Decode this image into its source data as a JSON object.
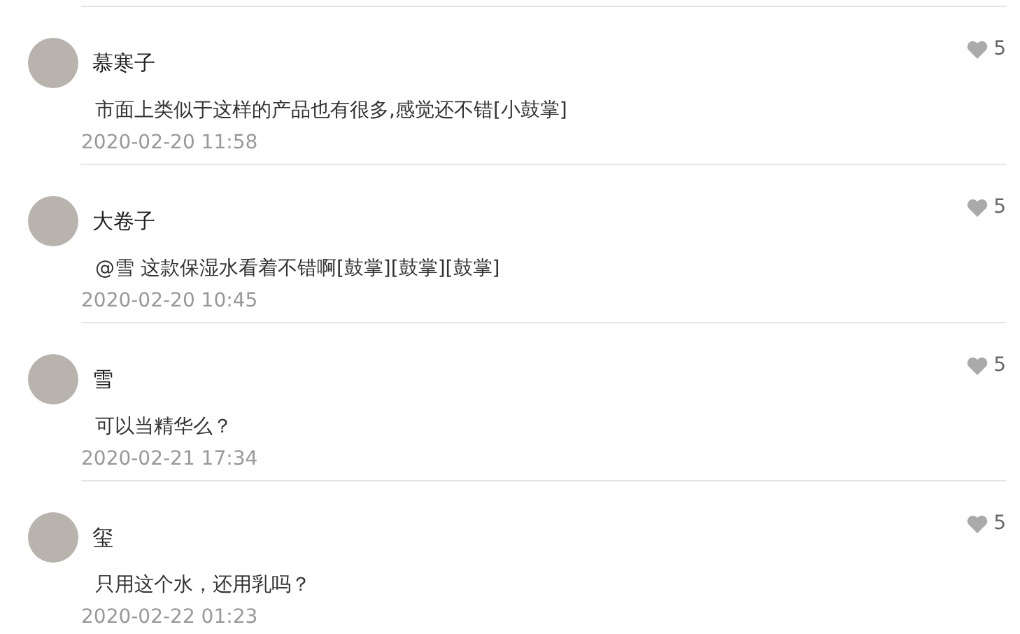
{
  "comments": [
    {
      "author": "慕寒子",
      "text": "市面上类似于这样的产品也有很多,感觉还不错[小鼓掌]",
      "time": "2020-02-20 11:58",
      "likes": "5"
    },
    {
      "author": "大卷子",
      "text": "@雪 这款保湿水看着不错啊[鼓掌][鼓掌][鼓掌]",
      "time": "2020-02-20 10:45",
      "likes": "5"
    },
    {
      "author": "雪",
      "text": "可以当精华么？",
      "time": "2020-02-21 17:34",
      "likes": "5"
    },
    {
      "author": "玺",
      "text": "只用这个水，还用乳吗？",
      "time": "2020-02-22 01:23",
      "likes": "5"
    }
  ]
}
